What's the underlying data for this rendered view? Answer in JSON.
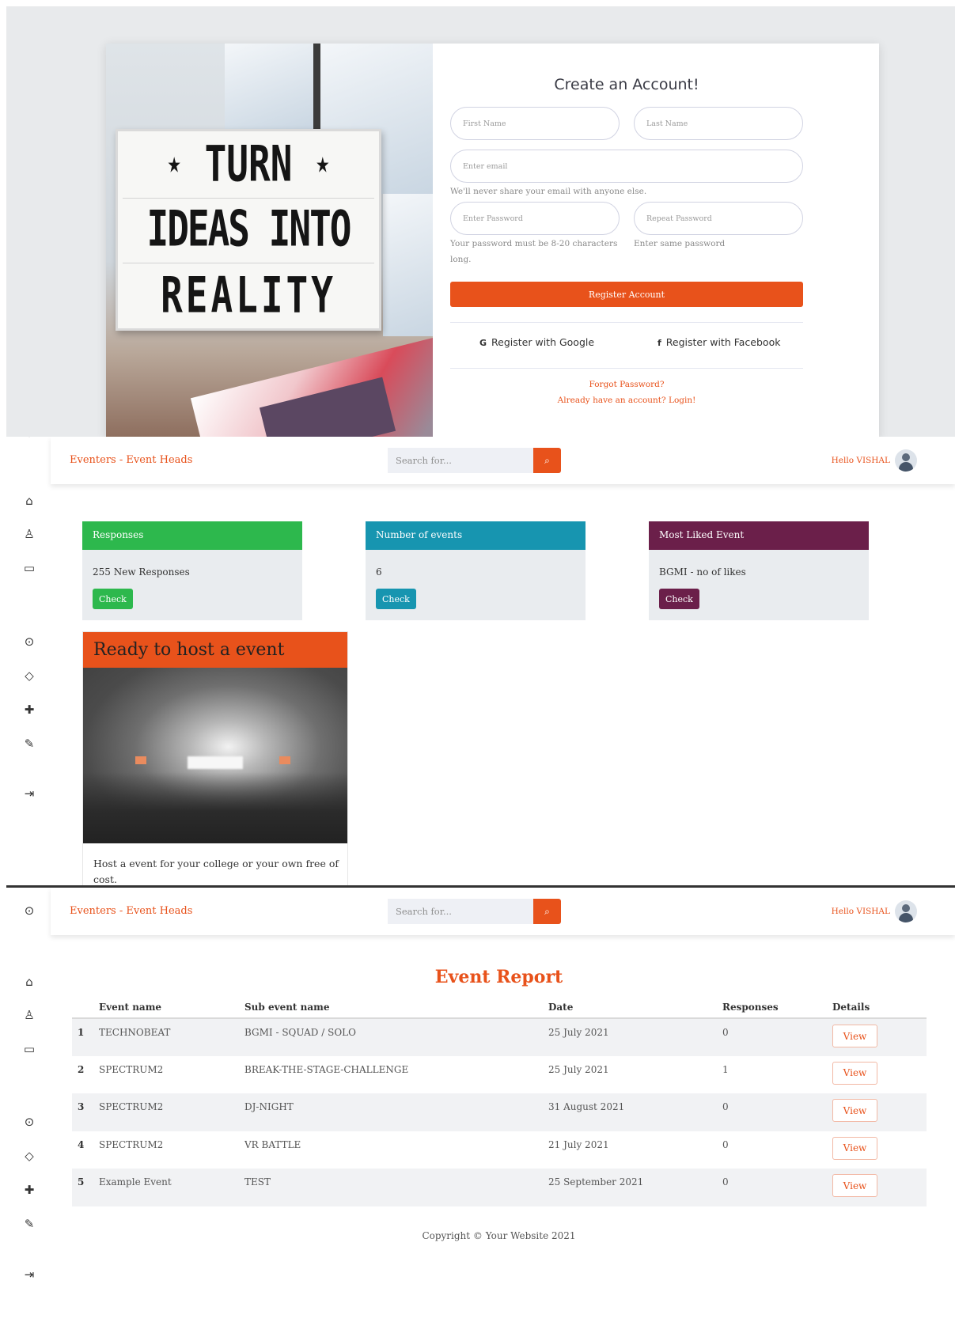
{
  "register": {
    "promo_lines": [
      "TURN",
      "IDEAS INTO",
      "REALITY"
    ],
    "promo_star": "★",
    "title": "Create an Account!",
    "first_name_placeholder": "First Name",
    "last_name_placeholder": "Last Name",
    "email_placeholder": "Enter email",
    "email_help": "We'll never share your email with anyone else.",
    "password_placeholder": "Enter Password",
    "repeat_password_placeholder": "Repeat Password",
    "password_help": "Your password must be 8-20 characters long.",
    "repeat_help": "Enter same password",
    "register_button": "Register Account",
    "google_button": "Register with Google",
    "google_icon": "G",
    "facebook_button": "Register with Facebook",
    "facebook_icon": "f",
    "forgot_link": "Forgot Password?",
    "login_link": "Already have an account? Login!"
  },
  "app": {
    "brand": "Eventers - Event Heads",
    "search_placeholder": "Search for...",
    "search_icon": "⌕",
    "user_greeting": "Hello VISHAL"
  },
  "dashboard": {
    "cards": [
      {
        "title": "Responses",
        "text": "255 New Responses",
        "button": "Check",
        "color": "#2db84d"
      },
      {
        "title": "Number of events",
        "text": "6",
        "button": "Check",
        "color": "#1795b0"
      },
      {
        "title": "Most Liked Event",
        "text": "BGMI - no of likes",
        "button": "Check",
        "color": "#6b1f4a"
      }
    ],
    "host": {
      "title": "Ready to host a event",
      "text": "Host a event for your college or your own free of cost."
    }
  },
  "report": {
    "title": "Event Report",
    "columns": [
      "",
      "Event name",
      "Sub event name",
      "Date",
      "Responses",
      "Details"
    ],
    "rows": [
      {
        "no": "1",
        "event": "TECHNOBEAT",
        "sub": "BGMI - SQUAD / SOLO",
        "date": "25 July 2021",
        "responses": "0",
        "action": "View"
      },
      {
        "no": "2",
        "event": "SPECTRUM2",
        "sub": "BREAK-THE-STAGE-CHALLENGE",
        "date": "25 July 2021",
        "responses": "1",
        "action": "View"
      },
      {
        "no": "3",
        "event": "SPECTRUM2",
        "sub": "DJ-NIGHT",
        "date": "31 August 2021",
        "responses": "0",
        "action": "View"
      },
      {
        "no": "4",
        "event": "SPECTRUM2",
        "sub": "VR BATTLE",
        "date": "21 July 2021",
        "responses": "0",
        "action": "View"
      },
      {
        "no": "5",
        "event": "Example Event",
        "sub": "TEST",
        "date": "25 September 2021",
        "responses": "0",
        "action": "View"
      }
    ],
    "copyright": "Copyright © Your Website 2021"
  },
  "colors": {
    "accent": "#e8521b"
  }
}
